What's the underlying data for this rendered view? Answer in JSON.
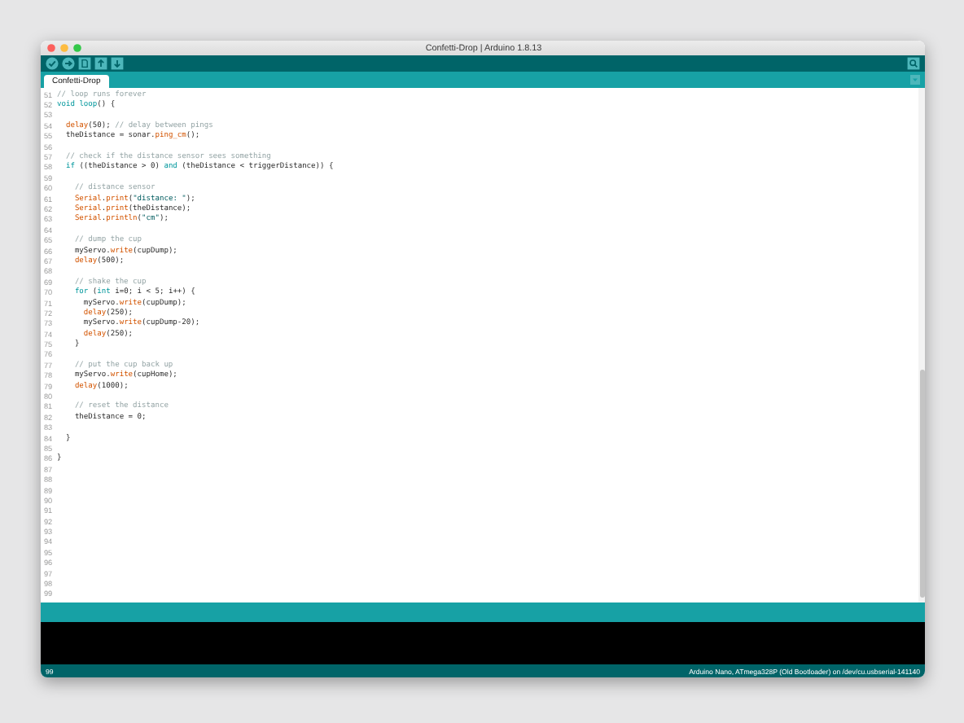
{
  "window": {
    "title": "Confetti-Drop | Arduino 1.8.13"
  },
  "tabs": [
    {
      "label": "Confetti-Drop",
      "selected": true
    }
  ],
  "editor": {
    "lines": [
      {
        "number": "51",
        "segments": [
          {
            "kind": "comment",
            "text": "// loop runs forever"
          }
        ]
      },
      {
        "number": "52",
        "segments": [
          {
            "kind": "keyword",
            "text": "void"
          },
          {
            "kind": "keyword",
            "text": " loop"
          },
          {
            "kind": "plain",
            "text": "() {"
          }
        ]
      },
      {
        "number": "53"
      },
      {
        "number": "54",
        "segments": [
          {
            "kind": "function",
            "text": "  delay"
          },
          {
            "kind": "plain",
            "text": "(50); "
          },
          {
            "kind": "comment",
            "text": "// delay between pings"
          }
        ]
      },
      {
        "number": "55",
        "segments": [
          {
            "kind": "plain",
            "text": "  theDistance = sonar."
          },
          {
            "kind": "function",
            "text": "ping_cm"
          },
          {
            "kind": "plain",
            "text": "();"
          }
        ]
      },
      {
        "number": "56"
      },
      {
        "number": "57",
        "segments": [
          {
            "kind": "comment",
            "text": "  // check if the distance sensor sees something"
          }
        ]
      },
      {
        "number": "58",
        "segments": [
          {
            "kind": "keyword",
            "text": "  if"
          },
          {
            "kind": "plain",
            "text": " ((theDistance > 0) "
          },
          {
            "kind": "keyword",
            "text": "and"
          },
          {
            "kind": "plain",
            "text": " (theDistance < triggerDistance)) {"
          }
        ]
      },
      {
        "number": "59"
      },
      {
        "number": "60",
        "segments": [
          {
            "kind": "comment",
            "text": "    // distance sensor"
          }
        ]
      },
      {
        "number": "61",
        "segments": [
          {
            "kind": "function",
            "text": "    Serial"
          },
          {
            "kind": "plain",
            "text": "."
          },
          {
            "kind": "function",
            "text": "print"
          },
          {
            "kind": "plain",
            "text": "("
          },
          {
            "kind": "string",
            "text": "\"distance: \""
          },
          {
            "kind": "plain",
            "text": ");"
          }
        ]
      },
      {
        "number": "62",
        "segments": [
          {
            "kind": "function",
            "text": "    Serial"
          },
          {
            "kind": "plain",
            "text": "."
          },
          {
            "kind": "function",
            "text": "print"
          },
          {
            "kind": "plain",
            "text": "(theDistance);"
          }
        ]
      },
      {
        "number": "63",
        "segments": [
          {
            "kind": "function",
            "text": "    Serial"
          },
          {
            "kind": "plain",
            "text": "."
          },
          {
            "kind": "function",
            "text": "println"
          },
          {
            "kind": "plain",
            "text": "("
          },
          {
            "kind": "string",
            "text": "\"cm\""
          },
          {
            "kind": "plain",
            "text": ");"
          }
        ]
      },
      {
        "number": "64"
      },
      {
        "number": "65",
        "segments": [
          {
            "kind": "comment",
            "text": "    // dump the cup"
          }
        ]
      },
      {
        "number": "66",
        "segments": [
          {
            "kind": "plain",
            "text": "    myServo."
          },
          {
            "kind": "function",
            "text": "write"
          },
          {
            "kind": "plain",
            "text": "(cupDump);"
          }
        ]
      },
      {
        "number": "67",
        "segments": [
          {
            "kind": "function",
            "text": "    delay"
          },
          {
            "kind": "plain",
            "text": "(500);"
          }
        ]
      },
      {
        "number": "68"
      },
      {
        "number": "69",
        "segments": [
          {
            "kind": "comment",
            "text": "    // shake the cup"
          }
        ]
      },
      {
        "number": "70",
        "segments": [
          {
            "kind": "keyword",
            "text": "    for"
          },
          {
            "kind": "plain",
            "text": " ("
          },
          {
            "kind": "keyword",
            "text": "int"
          },
          {
            "kind": "plain",
            "text": " i=0; i < 5; i++) {"
          }
        ]
      },
      {
        "number": "71",
        "segments": [
          {
            "kind": "plain",
            "text": "      myServo."
          },
          {
            "kind": "function",
            "text": "write"
          },
          {
            "kind": "plain",
            "text": "(cupDump);"
          }
        ]
      },
      {
        "number": "72",
        "segments": [
          {
            "kind": "function",
            "text": "      delay"
          },
          {
            "kind": "plain",
            "text": "(250);"
          }
        ]
      },
      {
        "number": "73",
        "segments": [
          {
            "kind": "plain",
            "text": "      myServo."
          },
          {
            "kind": "function",
            "text": "write"
          },
          {
            "kind": "plain",
            "text": "(cupDump-20);"
          }
        ]
      },
      {
        "number": "74",
        "segments": [
          {
            "kind": "function",
            "text": "      delay"
          },
          {
            "kind": "plain",
            "text": "(250);"
          }
        ]
      },
      {
        "number": "75",
        "segments": [
          {
            "kind": "plain",
            "text": "    }"
          }
        ]
      },
      {
        "number": "76"
      },
      {
        "number": "77",
        "segments": [
          {
            "kind": "comment",
            "text": "    // put the cup back up"
          }
        ]
      },
      {
        "number": "78",
        "segments": [
          {
            "kind": "plain",
            "text": "    myServo."
          },
          {
            "kind": "function",
            "text": "write"
          },
          {
            "kind": "plain",
            "text": "(cupHome);"
          }
        ]
      },
      {
        "number": "79",
        "segments": [
          {
            "kind": "function",
            "text": "    delay"
          },
          {
            "kind": "plain",
            "text": "(1000);"
          }
        ]
      },
      {
        "number": "80"
      },
      {
        "number": "81",
        "segments": [
          {
            "kind": "comment",
            "text": "    // reset the distance"
          }
        ]
      },
      {
        "number": "82",
        "segments": [
          {
            "kind": "plain",
            "text": "    theDistance = 0;"
          }
        ]
      },
      {
        "number": "83"
      },
      {
        "number": "84",
        "segments": [
          {
            "kind": "plain",
            "text": "  }"
          }
        ]
      },
      {
        "number": "85"
      },
      {
        "number": "86",
        "segments": [
          {
            "kind": "plain",
            "text": "}"
          }
        ]
      },
      {
        "number": "87"
      },
      {
        "number": "88"
      },
      {
        "number": "89"
      },
      {
        "number": "90"
      },
      {
        "number": "91"
      },
      {
        "number": "92"
      },
      {
        "number": "93"
      },
      {
        "number": "94"
      },
      {
        "number": "95"
      },
      {
        "number": "96"
      },
      {
        "number": "97"
      },
      {
        "number": "98"
      },
      {
        "number": "99"
      }
    ]
  },
  "status_bar": {
    "line": "99",
    "board": "Arduino Nano, ATmega328P (Old Bootloader) on /dev/cu.usbserial-141140"
  }
}
